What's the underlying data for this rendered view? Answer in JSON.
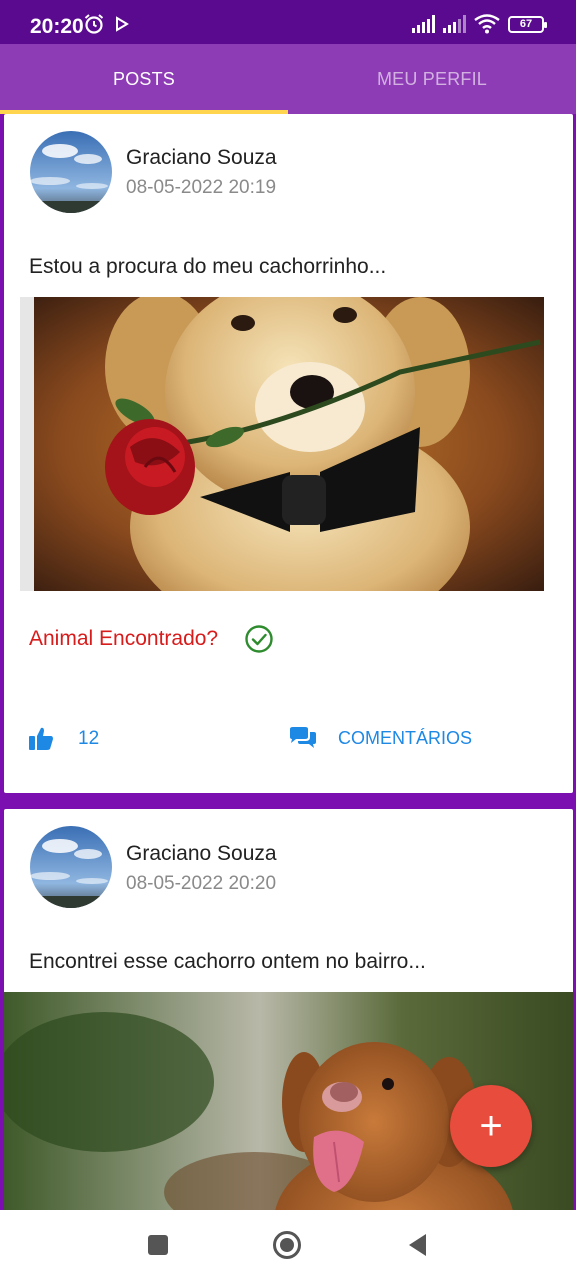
{
  "status_bar": {
    "time": "20:20",
    "battery": "67",
    "icons": [
      "alarm-icon",
      "play-icon",
      "signal-icon",
      "signal-icon",
      "wifi-icon",
      "battery-icon"
    ]
  },
  "tabs": [
    {
      "label": "POSTS",
      "active": true
    },
    {
      "label": "MEU PERFIL",
      "active": false
    }
  ],
  "posts": [
    {
      "author": "Graciano Souza",
      "date": "08-05-2022 20:19",
      "text": "Estou a procura do meu cachorrinho...",
      "found_label": "Animal Encontrado?",
      "likes": "12",
      "comments_label": "COMENTÁRIOS"
    },
    {
      "author": "Graciano Souza",
      "date": "08-05-2022 20:20",
      "text": "Encontrei esse cachorro ontem no bairro..."
    }
  ],
  "fab": {
    "label": "+"
  },
  "colors": {
    "status_bar": "#5a0a8f",
    "tab_bar": "#8e3cb5",
    "tab_indicator": "#ffd54f",
    "background": "#7b0fb0",
    "found_label": "#d81b1b",
    "action_blue": "#1e88e5",
    "fab": "#e74c3c",
    "check": "#2e8b2e"
  }
}
